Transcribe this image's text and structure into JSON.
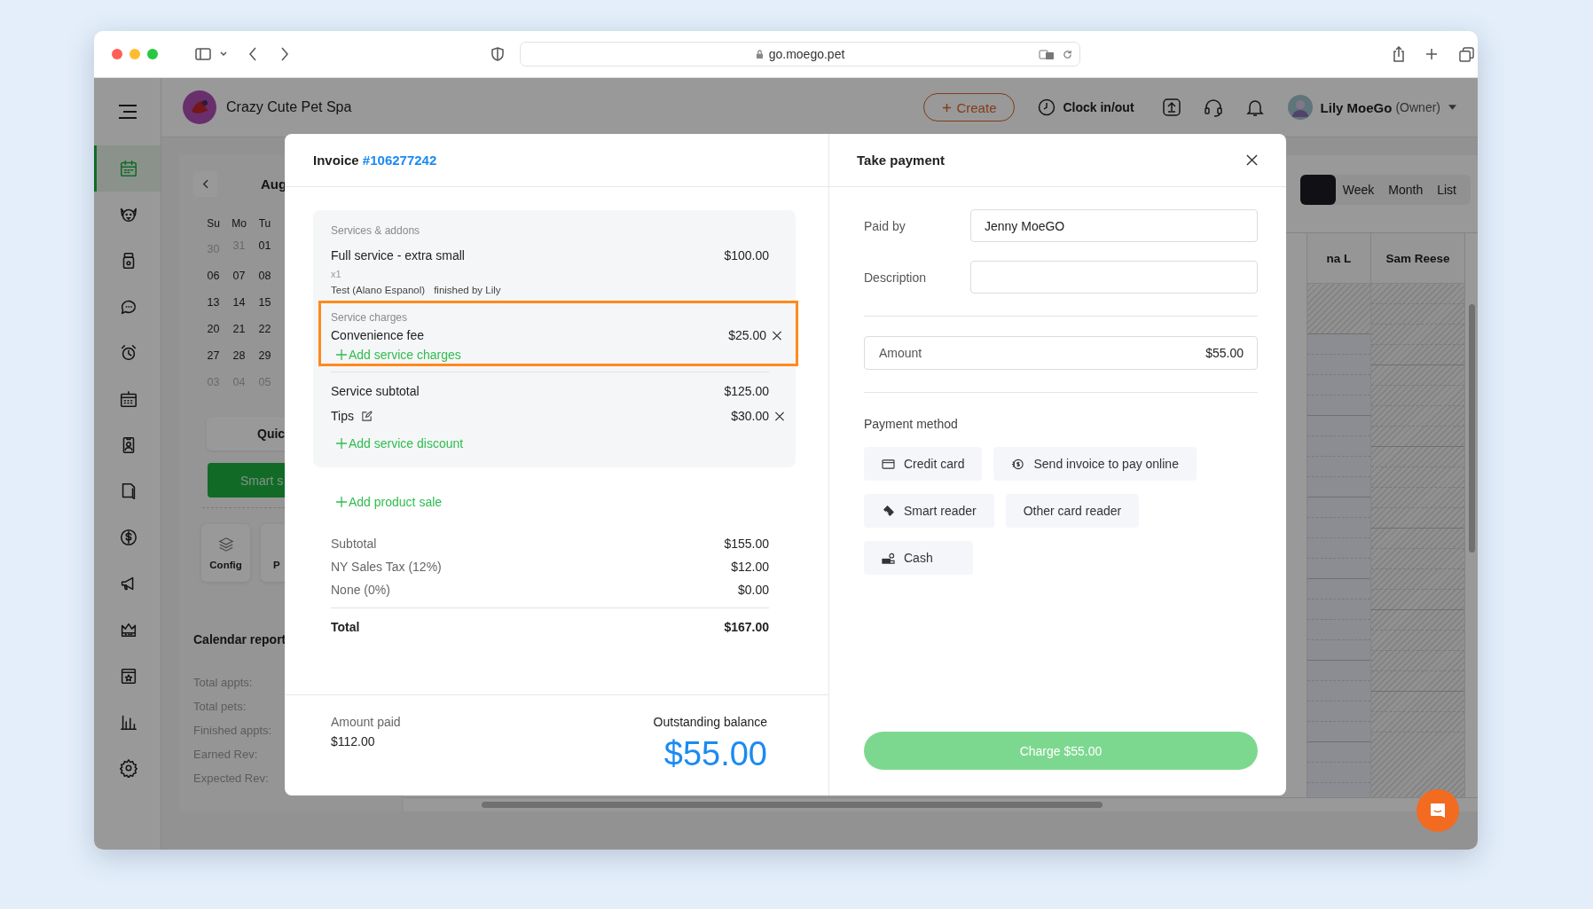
{
  "browser": {
    "url": "go.moego.pet"
  },
  "header": {
    "business_name": "Crazy Cute Pet Spa",
    "create_label": "Create",
    "clock_label": "Clock in/out",
    "user_name": "Lily MoeGo",
    "user_role": "(Owner)"
  },
  "nav_items": [
    {
      "selected": true
    },
    {
      "selected": false
    },
    {
      "selected": false
    },
    {
      "selected": false
    },
    {
      "selected": false
    },
    {
      "selected": false
    },
    {
      "selected": false
    },
    {
      "selected": false
    },
    {
      "selected": false
    },
    {
      "selected": false
    },
    {
      "selected": false
    },
    {
      "selected": false
    },
    {
      "selected": false
    },
    {
      "selected": false
    }
  ],
  "mini_calendar": {
    "month": "Aug",
    "weekdays": [
      "Su",
      "Mo",
      "Tu"
    ],
    "weeks": [
      [
        {
          "day": "30",
          "outside_month": true
        },
        {
          "day": "31",
          "outside_month": true
        },
        {
          "day": "01",
          "outside_month": false
        }
      ],
      [
        {
          "day": "06",
          "outside_month": false
        },
        {
          "day": "07",
          "outside_month": false
        },
        {
          "day": "08",
          "outside_month": false
        }
      ],
      [
        {
          "day": "13",
          "outside_month": false
        },
        {
          "day": "14",
          "outside_month": false
        },
        {
          "day": "15",
          "outside_month": false
        }
      ],
      [
        {
          "day": "20",
          "outside_month": false
        },
        {
          "day": "21",
          "outside_month": false
        },
        {
          "day": "22",
          "outside_month": false
        }
      ],
      [
        {
          "day": "27",
          "outside_month": false
        },
        {
          "day": "28",
          "outside_month": false
        },
        {
          "day": "29",
          "outside_month": false
        }
      ],
      [
        {
          "day": "03",
          "outside_month": true
        },
        {
          "day": "04",
          "outside_month": true
        },
        {
          "day": "05",
          "outside_month": true
        }
      ]
    ]
  },
  "quick_button": "Quic",
  "smart_button": "Smart s",
  "tools": [
    {
      "label": "Config"
    },
    {
      "label": "P"
    }
  ],
  "calendar_report": {
    "title": "Calendar report",
    "rows": [
      "Total appts:",
      "Total pets:",
      "Finished appts:",
      "Earned Rev:",
      "Expected Rev:"
    ]
  },
  "view_options": [
    {
      "selected": true
    },
    {
      "label": "Week",
      "selected": false
    },
    {
      "label": "Month",
      "selected": false
    },
    {
      "label": "List",
      "selected": false
    }
  ],
  "staff_columns": [
    {
      "name": "na L",
      "kind": "partly_blocked"
    },
    {
      "name": "Sam Reese",
      "kind": "blocked"
    }
  ],
  "invoice": {
    "title": "Invoice",
    "number": "#106277242",
    "services_heading": "Services & addons",
    "services": [
      {
        "name": "Full service - extra small",
        "quantity": "x1",
        "pet": "Test (Alano Espanol)",
        "staff": "finished by Lily",
        "price": "$100.00"
      }
    ],
    "charges": {
      "heading": "Service charges",
      "highlighted": true,
      "items": [
        {
          "name": "Convenience fee",
          "price": "$25.00"
        }
      ],
      "add_label": "Add service charges"
    },
    "service_subtotal": {
      "label": "Service subtotal",
      "value": "$125.00"
    },
    "tips": {
      "label": "Tips",
      "value": "$30.00"
    },
    "add_discount": "Add service discount",
    "add_product": "Add product sale",
    "totals": [
      {
        "label": "Subtotal",
        "value": "$155.00"
      },
      {
        "label": "NY Sales Tax (12%)",
        "value": "$12.00"
      },
      {
        "label": "None (0%)",
        "value": "$0.00"
      }
    ],
    "total": {
      "label": "Total",
      "value": "$167.00"
    },
    "amount_paid": {
      "label": "Amount paid",
      "value": "$112.00"
    },
    "outstanding": {
      "label": "Outstanding balance",
      "value": "$55.00"
    }
  },
  "payment": {
    "title": "Take payment",
    "fields": [
      {
        "label": "Paid by",
        "value": "Jenny MoeGO"
      },
      {
        "label": "Description"
      }
    ],
    "amount": {
      "label": "Amount",
      "value": "$55.00"
    },
    "method_heading": "Payment method",
    "method_rows": [
      [
        {
          "label": "Credit card",
          "kind": "card"
        },
        {
          "label": "Send invoice to pay online",
          "kind": "online"
        }
      ],
      [
        {
          "label": "Smart reader",
          "kind": "reader"
        },
        {
          "label": "Other card reader",
          "kind": "plain"
        }
      ],
      [
        {
          "label": "Cash",
          "kind": "cash"
        }
      ]
    ],
    "charge_button": "Charge $55.00"
  }
}
